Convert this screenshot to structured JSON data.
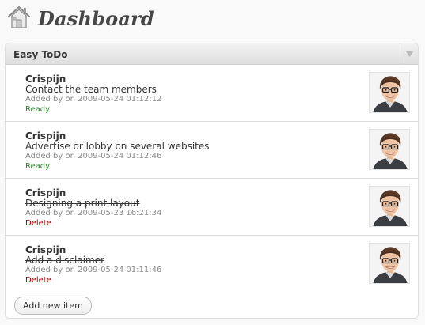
{
  "page": {
    "title": "Dashboard",
    "icon": "home-icon"
  },
  "widget": {
    "title": "Easy ToDo",
    "toggle_icon": "triangle-down-icon"
  },
  "items": [
    {
      "author": "Crispijn",
      "text": "Contact the team members",
      "meta": "Added by on 2009-05-24 01:12:12",
      "action": "Ready",
      "done": false
    },
    {
      "author": "Crispijn",
      "text": "Advertise or lobby on several websites",
      "meta": "Added by on 2009-05-24 01:12:46",
      "action": "Ready",
      "done": false
    },
    {
      "author": "Crispijn",
      "text": "Designing a print layout",
      "meta": "Added by on 2009-05-23 16:21:34",
      "action": "Delete",
      "done": true
    },
    {
      "author": "Crispijn",
      "text": "Add a disclaimer",
      "meta": "Added by on 2009-05-24 01:11:46",
      "action": "Delete",
      "done": true
    }
  ],
  "add_button_label": "Add new item",
  "colors": {
    "ready": "#228b22",
    "delete": "#aa0000",
    "meta": "#888888"
  }
}
